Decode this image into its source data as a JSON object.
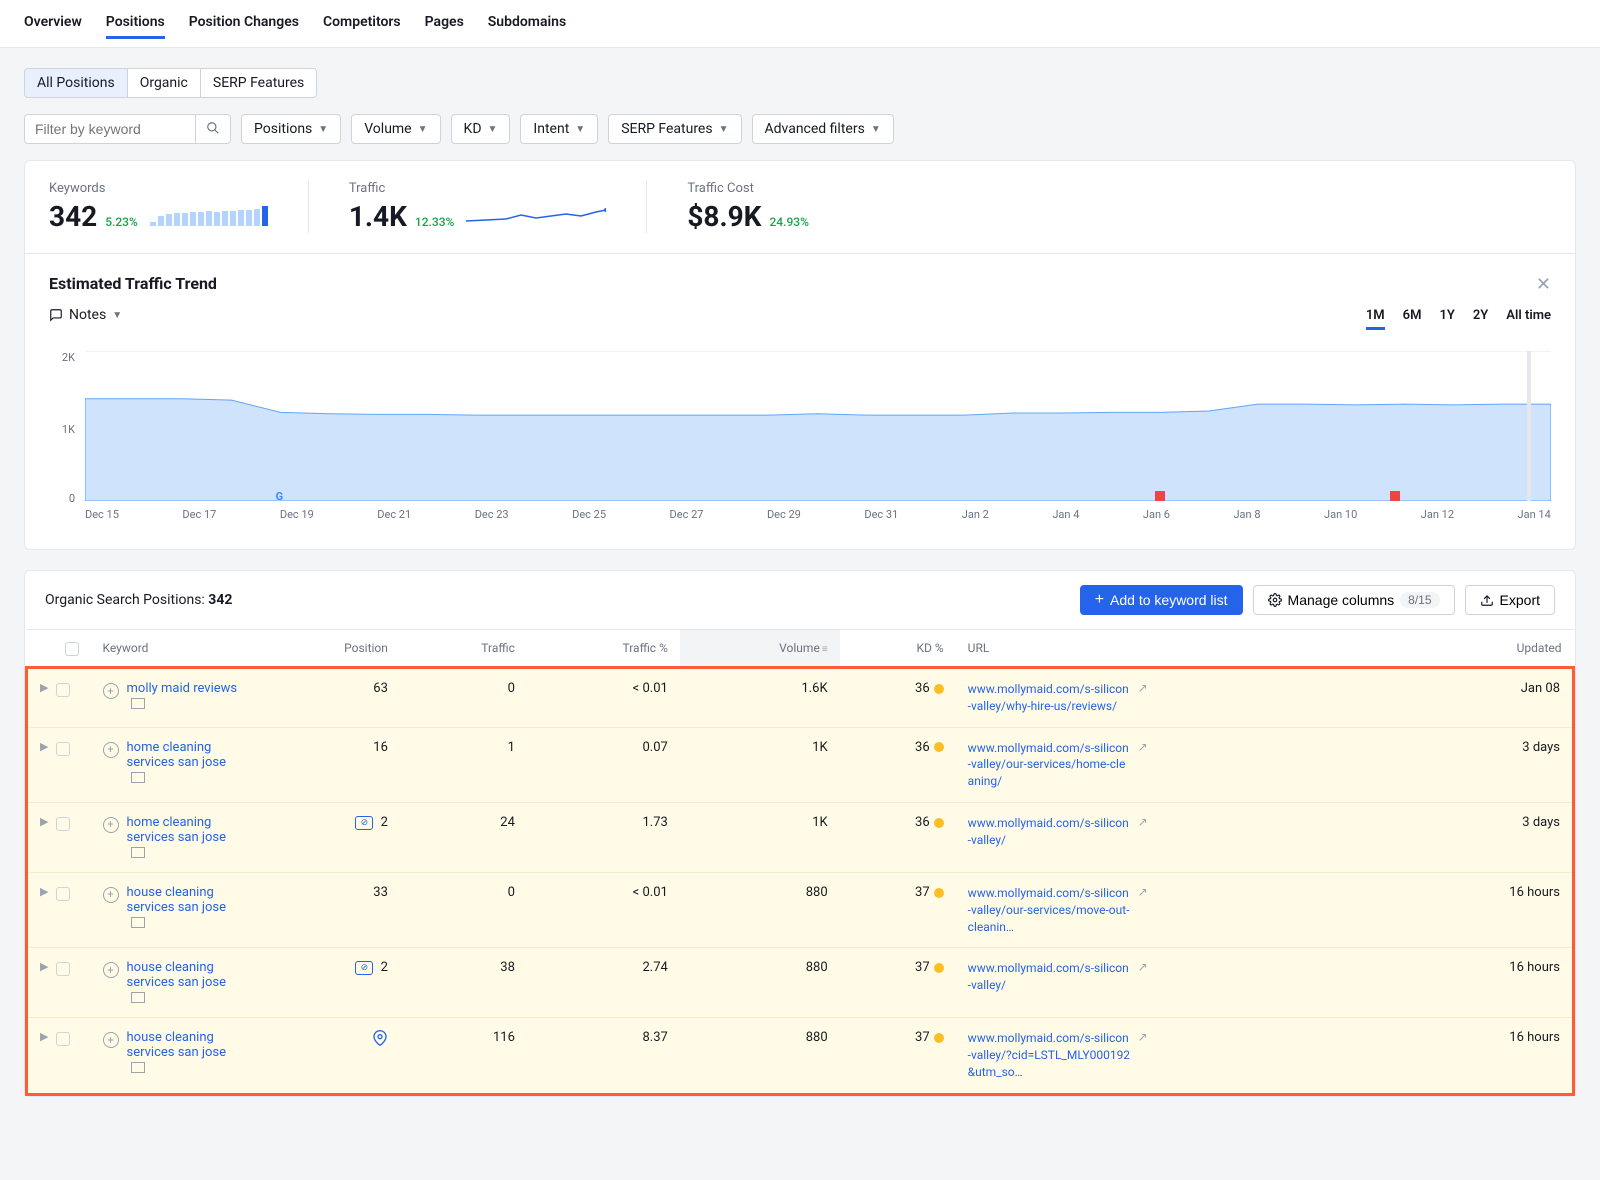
{
  "tabs": [
    "Overview",
    "Positions",
    "Position Changes",
    "Competitors",
    "Pages",
    "Subdomains"
  ],
  "activeTab": "Positions",
  "filterTabs": [
    "All Positions",
    "Organic",
    "SERP Features"
  ],
  "filterPlaceholder": "Filter by keyword",
  "pills": [
    "Positions",
    "Volume",
    "KD",
    "Intent",
    "SERP Features",
    "Advanced filters"
  ],
  "metrics": {
    "keywords": {
      "label": "Keywords",
      "value": "342",
      "change": "5.23%"
    },
    "traffic": {
      "label": "Traffic",
      "value": "1.4K",
      "change": "12.33%"
    },
    "cost": {
      "label": "Traffic Cost",
      "value": "$8.9K",
      "change": "24.93%"
    }
  },
  "chartTitle": "Estimated Traffic Trend",
  "notesLabel": "Notes",
  "ranges": [
    "1M",
    "6M",
    "1Y",
    "2Y",
    "All time"
  ],
  "chart_data": {
    "type": "area",
    "ylabel": "",
    "ylim": [
      0,
      2200
    ],
    "y_ticks": [
      0,
      1000,
      2000
    ],
    "y_tick_labels": [
      "0",
      "1K",
      "2K"
    ],
    "x_labels": [
      "Dec 15",
      "Dec 17",
      "Dec 19",
      "Dec 21",
      "Dec 23",
      "Dec 25",
      "Dec 27",
      "Dec 29",
      "Dec 31",
      "Jan 2",
      "Jan 4",
      "Jan 6",
      "Jan 8",
      "Jan 10",
      "Jan 12",
      "Jan 14"
    ],
    "series": [
      {
        "name": "Traffic",
        "values": [
          1500,
          1500,
          1500,
          1480,
          1300,
          1280,
          1270,
          1270,
          1260,
          1260,
          1260,
          1260,
          1260,
          1260,
          1260,
          1280,
          1260,
          1260,
          1260,
          1290,
          1290,
          1300,
          1300,
          1320,
          1420,
          1420,
          1410,
          1420,
          1410,
          1420,
          1420
        ]
      }
    ],
    "markers": [
      {
        "x": "Dec 19",
        "type": "G"
      },
      {
        "x": "Jan 7",
        "type": "red"
      },
      {
        "x": "Jan 12",
        "type": "red"
      }
    ]
  },
  "tableTitleA": "Organic Search Positions: ",
  "tableTitleB": "342",
  "actions": {
    "add": "Add to keyword list",
    "manage": "Manage columns",
    "manageBadge": "8/15",
    "export": "Export"
  },
  "columns": [
    "Keyword",
    "Position",
    "Traffic",
    "Traffic %",
    "Volume",
    "KD %",
    "URL",
    "Updated"
  ],
  "rows": [
    {
      "kw": "molly maid reviews",
      "pos": "63",
      "posIcon": "",
      "traffic": "0",
      "trafficPct": "< 0.01",
      "volume": "1.6K",
      "kd": "36",
      "url": "www.mollymaid.com/s-silicon-valley/why-hire-us/reviews/",
      "updated": "Jan 08"
    },
    {
      "kw": "home cleaning services san jose",
      "pos": "16",
      "posIcon": "",
      "traffic": "1",
      "trafficPct": "0.07",
      "volume": "1K",
      "kd": "36",
      "url": "www.mollymaid.com/s-silicon-valley/our-services/home-cleaning/",
      "updated": "3 days"
    },
    {
      "kw": "home cleaning services san jose",
      "pos": "2",
      "posIcon": "link",
      "traffic": "24",
      "trafficPct": "1.73",
      "volume": "1K",
      "kd": "36",
      "url": "www.mollymaid.com/s-silicon-valley/",
      "updated": "3 days"
    },
    {
      "kw": "house cleaning services san jose",
      "pos": "33",
      "posIcon": "",
      "traffic": "0",
      "trafficPct": "< 0.01",
      "volume": "880",
      "kd": "37",
      "url": "www.mollymaid.com/s-silicon-valley/our-services/move-out-cleanin…",
      "updated": "16 hours"
    },
    {
      "kw": "house cleaning services san jose",
      "pos": "2",
      "posIcon": "link",
      "traffic": "38",
      "trafficPct": "2.74",
      "volume": "880",
      "kd": "37",
      "url": "www.mollymaid.com/s-silicon-valley/",
      "updated": "16 hours"
    },
    {
      "kw": "house cleaning services san jose",
      "pos": "",
      "posIcon": "pin",
      "traffic": "116",
      "trafficPct": "8.37",
      "volume": "880",
      "kd": "37",
      "url": "www.mollymaid.com/s-silicon-valley/?cid=LSTL_MLY000192&utm_so…",
      "updated": "16 hours"
    }
  ]
}
